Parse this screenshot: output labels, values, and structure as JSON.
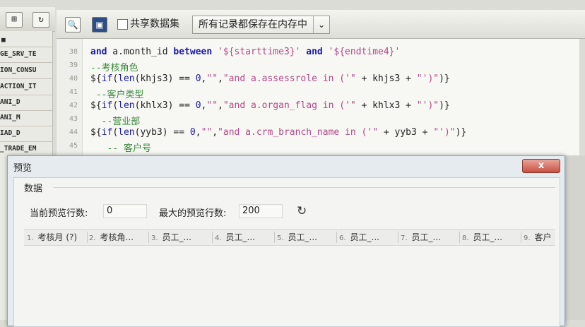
{
  "left_panel": {
    "toolbar_icons": [
      "report-icon",
      "refresh-icon"
    ],
    "tree_items": [
      "■",
      "GE_SRV_TE",
      "ION_CONSU",
      "ACTION_IT",
      "ANI_D",
      "ANI_M",
      "IAD_D",
      "_TRADE_EM"
    ]
  },
  "toolbar": {
    "share_dataset_label": "共享数据集",
    "share_dataset_checked": false,
    "storage_select_value": "所有记录都保存在内存中"
  },
  "editor": {
    "lines": [
      {
        "no": "38",
        "code": "and a.month_id between '${starttime3}' and '${endtime4}'"
      },
      {
        "no": "39",
        "code": "--考核角色"
      },
      {
        "no": "40",
        "code": "${if(len(khjs3) == 0,\"\",\"and a.assessrole in ('\" + khjs3 + \"')\")}"
      },
      {
        "no": "41",
        "code": " --客户类型"
      },
      {
        "no": "42",
        "code": "${if(len(khlx3) == 0,\"\",\"and a.organ_flag in ('\" + khlx3 + \"')\")}"
      },
      {
        "no": "43",
        "code": "  --营业部"
      },
      {
        "no": "44",
        "code": "${if(len(yyb3) == 0,\"\",\"and a.crm_branch_name in ('\" + yyb3 + \"')\")}"
      },
      {
        "no": "45",
        "code": "   -- 客户号"
      }
    ]
  },
  "dialog": {
    "title": "预览",
    "close_label": "x",
    "group_label": "数据",
    "current_rows_label": "当前预览行数:",
    "current_rows_value": "0",
    "max_rows_label": "最大的预览行数:",
    "max_rows_value": "200",
    "columns": [
      {
        "idx": "1.",
        "label": "考核月 (?)"
      },
      {
        "idx": "2.",
        "label": "考核角..."
      },
      {
        "idx": "3.",
        "label": "员工_..."
      },
      {
        "idx": "4.",
        "label": "员工_..."
      },
      {
        "idx": "5.",
        "label": "员工_..."
      },
      {
        "idx": "6.",
        "label": "员工_..."
      },
      {
        "idx": "7.",
        "label": "员工_..."
      },
      {
        "idx": "8.",
        "label": "员工_..."
      },
      {
        "idx": "9.",
        "label": "客户"
      }
    ]
  }
}
